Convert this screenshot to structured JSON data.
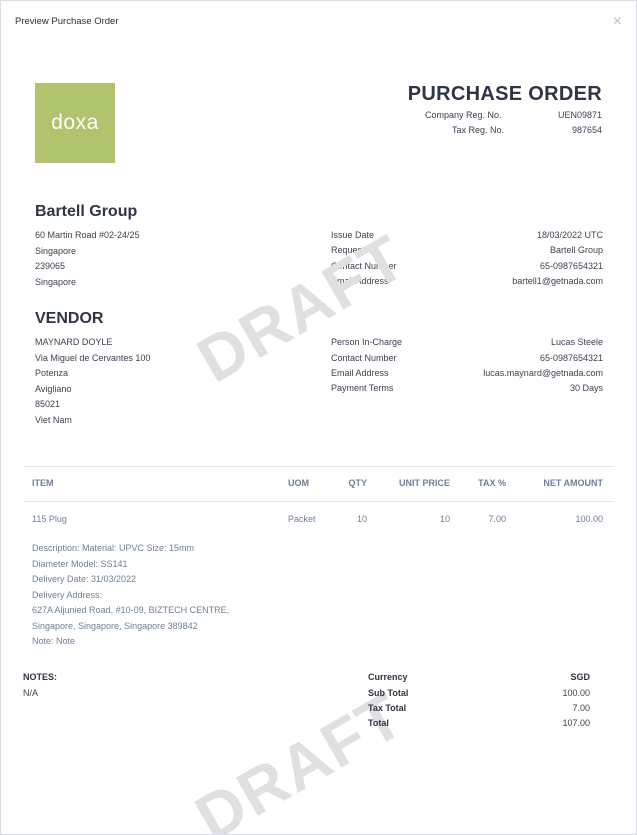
{
  "modal": {
    "title": "Preview Purchase Order",
    "close_glyph": "×"
  },
  "logo": {
    "text": "doxa",
    "color": "#afc46c"
  },
  "header": {
    "title": "PURCHASE ORDER",
    "company_reg_label": "Company Reg. No.",
    "company_reg_value": "UEN09871",
    "tax_reg_label": "Tax Reg. No.",
    "tax_reg_value": "987654"
  },
  "buyer": {
    "name": "Bartell Group",
    "address": [
      "60 Martin Road #02-24/25",
      "Singapore",
      "239065",
      "Singapore"
    ],
    "details": [
      {
        "label": "Issue Date",
        "value": "18/03/2022 UTC"
      },
      {
        "label": "Requestor",
        "value": "Bartell Group"
      },
      {
        "label": "Contact Number",
        "value": "65-0987654321"
      },
      {
        "label": "Email Address",
        "value": "bartell1@getnada.com"
      }
    ]
  },
  "vendor": {
    "title": "VENDOR",
    "address": [
      "MAYNARD DOYLE",
      "Via Miguel de Cervantes 100",
      "Potenza",
      "Avigliano",
      "85021",
      "Viet Nam"
    ],
    "details": [
      {
        "label": "Person In-Charge",
        "value": "Lucas Steele"
      },
      {
        "label": "Contact Number",
        "value": "65-0987654321"
      },
      {
        "label": "Email Address",
        "value": "lucas.maynard@getnada.com"
      },
      {
        "label": "Payment Terms",
        "value": "30 Days"
      }
    ]
  },
  "watermark": "DRAFT",
  "table": {
    "headers": {
      "item": "ITEM",
      "uom": "UOM",
      "qty": "QTY",
      "unit_price": "UNIT PRICE",
      "tax": "TAX %",
      "net_amount": "NET AMOUNT"
    },
    "row": {
      "item": "115 Plug",
      "uom": "Packet",
      "qty": "10",
      "unit_price": "10",
      "tax": "7.00",
      "net_amount": "100.00"
    },
    "description": [
      "Description: Material: UPVC Size: 15mm",
      "Diameter Model: SS141",
      "Delivery Date: 31/03/2022",
      "Delivery Address:",
      "627A Aljunied Road, #10-09, BIZTECH CENTRE,",
      "Singapore, Singapore, Singapore 389842",
      "Note: Note"
    ]
  },
  "notes": {
    "label": "NOTES:",
    "value": "N/A"
  },
  "totals": {
    "currency_label": "Currency",
    "currency_value": "SGD",
    "subtotal_label": "Sub Total",
    "subtotal_value": "100.00",
    "tax_label": "Tax Total",
    "tax_value": "7.00",
    "total_label": "Total",
    "total_value": "107.00"
  }
}
